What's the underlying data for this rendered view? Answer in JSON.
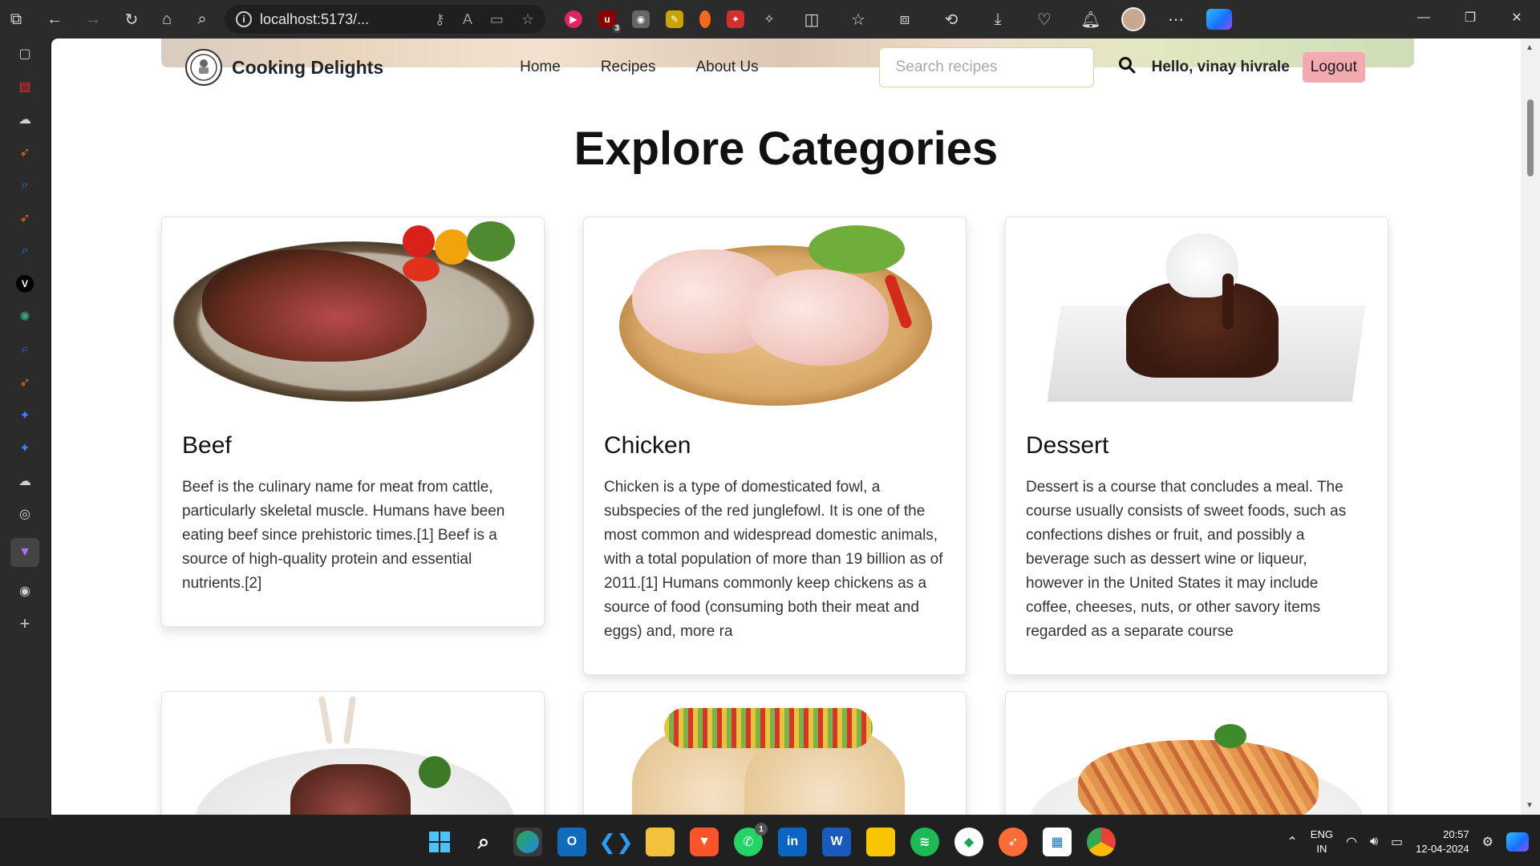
{
  "browser": {
    "url": "localhost:5173/...",
    "nav_icons": [
      "back-icon",
      "forward-icon",
      "refresh-icon",
      "home-icon",
      "search-icon"
    ],
    "extension_badges": {
      "ublock": "3"
    },
    "window_controls": [
      "minimize-icon",
      "restore-icon",
      "close-icon"
    ]
  },
  "site": {
    "brand": "Cooking Delights",
    "nav": [
      "Home",
      "Recipes",
      "About Us"
    ],
    "search_placeholder": "Search recipes",
    "greeting": "Hello, vinay hivrale",
    "logout": "Logout"
  },
  "page": {
    "title": "Explore Categories"
  },
  "categories": [
    {
      "name": "Beef",
      "description": "Beef is the culinary name for meat from cattle, particularly skeletal muscle. Humans have been eating beef since prehistoric times.[1] Beef is a source of high-quality protein and essential nutrients.[2]"
    },
    {
      "name": "Chicken",
      "description": "Chicken is a type of domesticated fowl, a subspecies of the red junglefowl. It is one of the most common and widespread domestic animals, with a total population of more than 19 billion as of 2011.[1] Humans commonly keep chickens as a source of food (consuming both their meat and eggs) and, more ra"
    },
    {
      "name": "Dessert",
      "description": "Dessert is a course that concludes a meal. The course usually consists of sweet foods, such as confections dishes or fruit, and possibly a beverage such as dessert wine or liqueur, however in the United States it may include coffee, cheeses, nuts, or other savory items regarded as a separate course"
    }
  ],
  "taskbar": {
    "language": "ENG",
    "region": "IN",
    "time": "20:57",
    "date": "12-04-2024",
    "whatsapp_badge": "1"
  },
  "colors": {
    "logout_bg": "#f3a9b0",
    "search_border": "#c9dd9a"
  }
}
